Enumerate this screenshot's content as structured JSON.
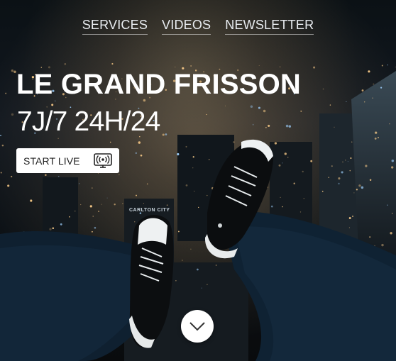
{
  "nav": {
    "items": [
      {
        "label": "SERVICES"
      },
      {
        "label": "VIDEOS"
      },
      {
        "label": "NEWSLETTER"
      }
    ]
  },
  "hero": {
    "title": "LE GRAND FRISSON",
    "subtitle": "7J/7 24H/24",
    "live_button_label": "START LIVE",
    "live_icon": "live-broadcast-icon",
    "scroll_icon": "chevron-down-icon",
    "building_sign": "CARLTON CITY"
  },
  "colors": {
    "background": "#0d0f12",
    "text": "#ffffff",
    "button_bg": "#ffffff",
    "button_text": "#222222",
    "city_light": "#ffcf8a"
  }
}
